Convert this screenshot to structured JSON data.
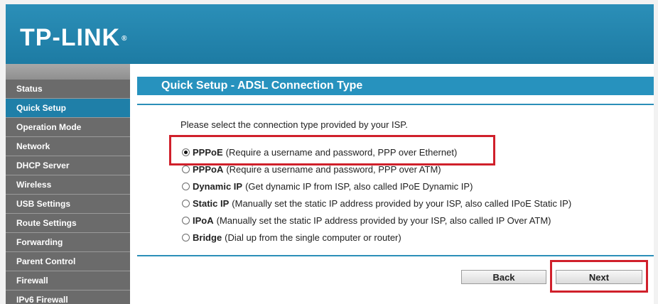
{
  "header": {
    "logo_text": "TP-LINK",
    "logo_mark": "®"
  },
  "sidebar": {
    "items": [
      {
        "label": "Status"
      },
      {
        "label": "Quick Setup",
        "active": true
      },
      {
        "label": "Operation Mode"
      },
      {
        "label": "Network"
      },
      {
        "label": "DHCP Server"
      },
      {
        "label": "Wireless"
      },
      {
        "label": "USB Settings"
      },
      {
        "label": "Route Settings"
      },
      {
        "label": "Forwarding"
      },
      {
        "label": "Parent Control"
      },
      {
        "label": "Firewall"
      },
      {
        "label": "IPv6 Firewall"
      }
    ]
  },
  "main": {
    "title": "Quick Setup - ADSL Connection Type",
    "prompt": "Please select the connection type provided by your ISP.",
    "options": [
      {
        "name": "PPPoE",
        "desc": "(Require a username and password, PPP over Ethernet)",
        "selected": true
      },
      {
        "name": "PPPoA",
        "desc": "(Require a username and password, PPP over ATM)",
        "selected": false
      },
      {
        "name": "Dynamic IP",
        "desc": "(Get dynamic IP from ISP, also called IPoE Dynamic IP)",
        "selected": false
      },
      {
        "name": "Static IP",
        "desc": "(Manually set the static IP address provided by your ISP, also called IPoE Static IP)",
        "selected": false
      },
      {
        "name": "IPoA",
        "desc": "(Manually set the static IP address provided by your ISP, also called IP Over ATM)",
        "selected": false
      },
      {
        "name": "Bridge",
        "desc": "(Dial up from the single computer or router)",
        "selected": false
      }
    ],
    "back_label": "Back",
    "next_label": "Next"
  },
  "colors": {
    "header": "#2b8fb8",
    "active_menu": "#1f7fa8",
    "menu": "#6b6b6b",
    "highlight": "#d0202b"
  }
}
